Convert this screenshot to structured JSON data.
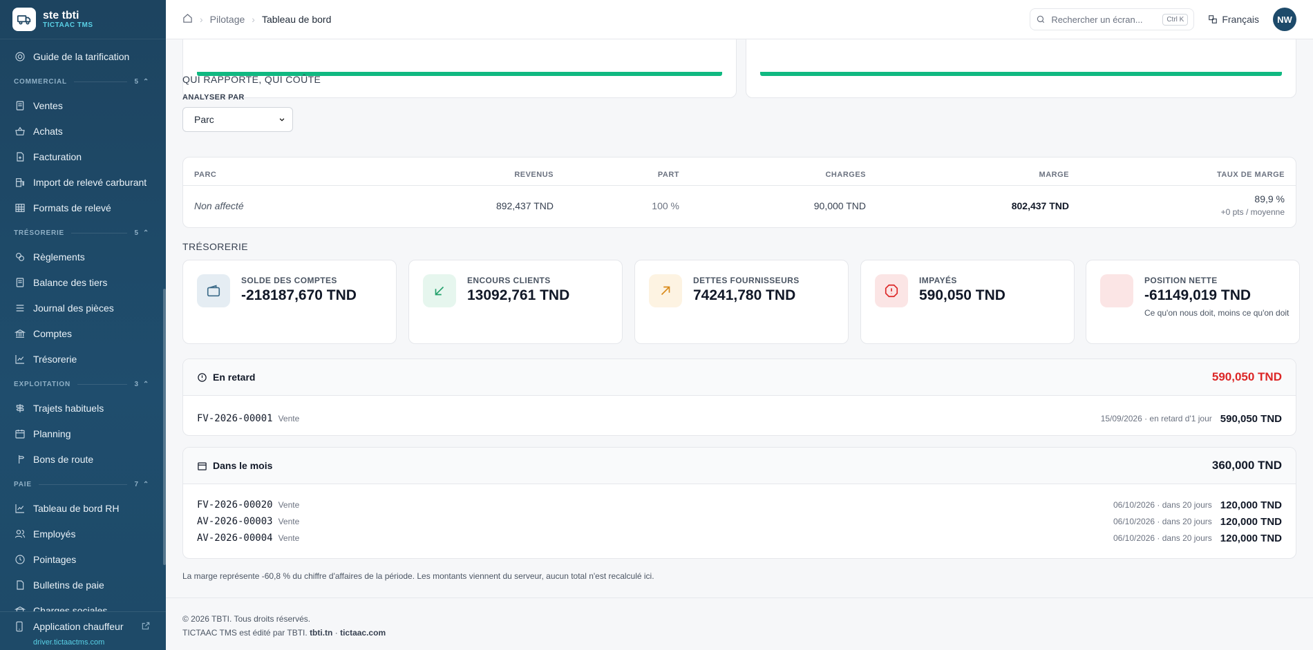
{
  "brand": {
    "name": "ste tbti",
    "product": "TICTAAC TMS"
  },
  "sidebar": {
    "top_item": {
      "label": "Guide de la tarification"
    },
    "sections": [
      {
        "title": "COMMERCIAL",
        "count": "5",
        "items": [
          "Ventes",
          "Achats",
          "Facturation",
          "Import de relevé carburant",
          "Formats de relevé"
        ]
      },
      {
        "title": "TRÉSORERIE",
        "count": "5",
        "items": [
          "Règlements",
          "Balance des tiers",
          "Journal des pièces",
          "Comptes",
          "Trésorerie"
        ]
      },
      {
        "title": "EXPLOITATION",
        "count": "3",
        "items": [
          "Trajets habituels",
          "Planning",
          "Bons de route"
        ]
      },
      {
        "title": "PAIE",
        "count": "7",
        "items": [
          "Tableau de bord RH",
          "Employés",
          "Pointages",
          "Bulletins de paie",
          "Charges sociales"
        ]
      }
    ],
    "footer": {
      "app_label": "Application chauffeur",
      "url": "driver.tictaactms.com"
    }
  },
  "topbar": {
    "breadcrumb": [
      "Pilotage",
      "Tableau de bord"
    ],
    "search_placeholder": "Rechercher un écran...",
    "search_shortcut": "Ctrl K",
    "language": "Français",
    "avatar_initials": "NW"
  },
  "profitability": {
    "title": "QUI RAPPORTE, QUI COÛTE",
    "analyze_label": "ANALYSER PAR",
    "analyze_value": "Parc",
    "columns": [
      "PARC",
      "REVENUS",
      "PART",
      "CHARGES",
      "MARGE",
      "TAUX DE MARGE"
    ],
    "rows": [
      {
        "parc": "Non affecté",
        "revenus": "892,437 TND",
        "part": "100 %",
        "charges": "90,000 TND",
        "marge": "802,437 TND",
        "taux": "89,9 %",
        "taux_sub": "+0 pts / moyenne"
      }
    ]
  },
  "treasury": {
    "title": "TRÉSORERIE",
    "kpis": [
      {
        "label": "SOLDE DES COMPTES",
        "value": "-218187,670 TND",
        "sub": "",
        "icon": "wallet-icon",
        "bg": "#e5edf3",
        "color": "#3b6a88"
      },
      {
        "label": "ENCOURS CLIENTS",
        "value": "13092,761 TND",
        "sub": "",
        "icon": "arrow-down-left-icon",
        "bg": "#e6f6ee",
        "color": "#22a06b"
      },
      {
        "label": "DETTES FOURNISSEURS",
        "value": "74241,780 TND",
        "sub": "",
        "icon": "arrow-up-right-icon",
        "bg": "#fdf3e2",
        "color": "#d98a1a"
      },
      {
        "label": "IMPAYÉS",
        "value": "590,050 TND",
        "sub": "",
        "icon": "alert-octagon-icon",
        "bg": "#fbe5e5",
        "color": "#dc2626"
      },
      {
        "label": "POSITION NETTE",
        "value": "-61149,019 TND",
        "sub": "Ce qu'on nous doit, moins ce qu'on doit",
        "icon": "",
        "bg": "#fbe5e5",
        "color": "#dc2626"
      }
    ]
  },
  "late": {
    "title": "En retard",
    "total": "590,050 TND",
    "total_color": "#dc2626",
    "rows": [
      {
        "ref": "FV-2026-00001",
        "kind": "Vente",
        "date": "15/09/2026 · en retard d'1 jour",
        "amount": "590,050 TND"
      }
    ]
  },
  "month": {
    "title": "Dans le mois",
    "total": "360,000 TND",
    "rows": [
      {
        "ref": "FV-2026-00020",
        "kind": "Vente",
        "date": "06/10/2026 · dans 20 jours",
        "amount": "120,000 TND"
      },
      {
        "ref": "AV-2026-00003",
        "kind": "Vente",
        "date": "06/10/2026 · dans 20 jours",
        "amount": "120,000 TND"
      },
      {
        "ref": "AV-2026-00004",
        "kind": "Vente",
        "date": "06/10/2026 · dans 20 jours",
        "amount": "120,000 TND"
      }
    ]
  },
  "note": "La marge représente -60,8 % du chiffre d'affaires de la période. Les montants viennent du serveur, aucun total n'est recalculé ici.",
  "footer": {
    "copyright": "© 2026 TBTI. Tous droits réservés.",
    "edited_by": "TICTAAC TMS est édité par TBTI.",
    "link1": "tbti.tn",
    "dot": "·",
    "link2": "tictaac.com"
  }
}
